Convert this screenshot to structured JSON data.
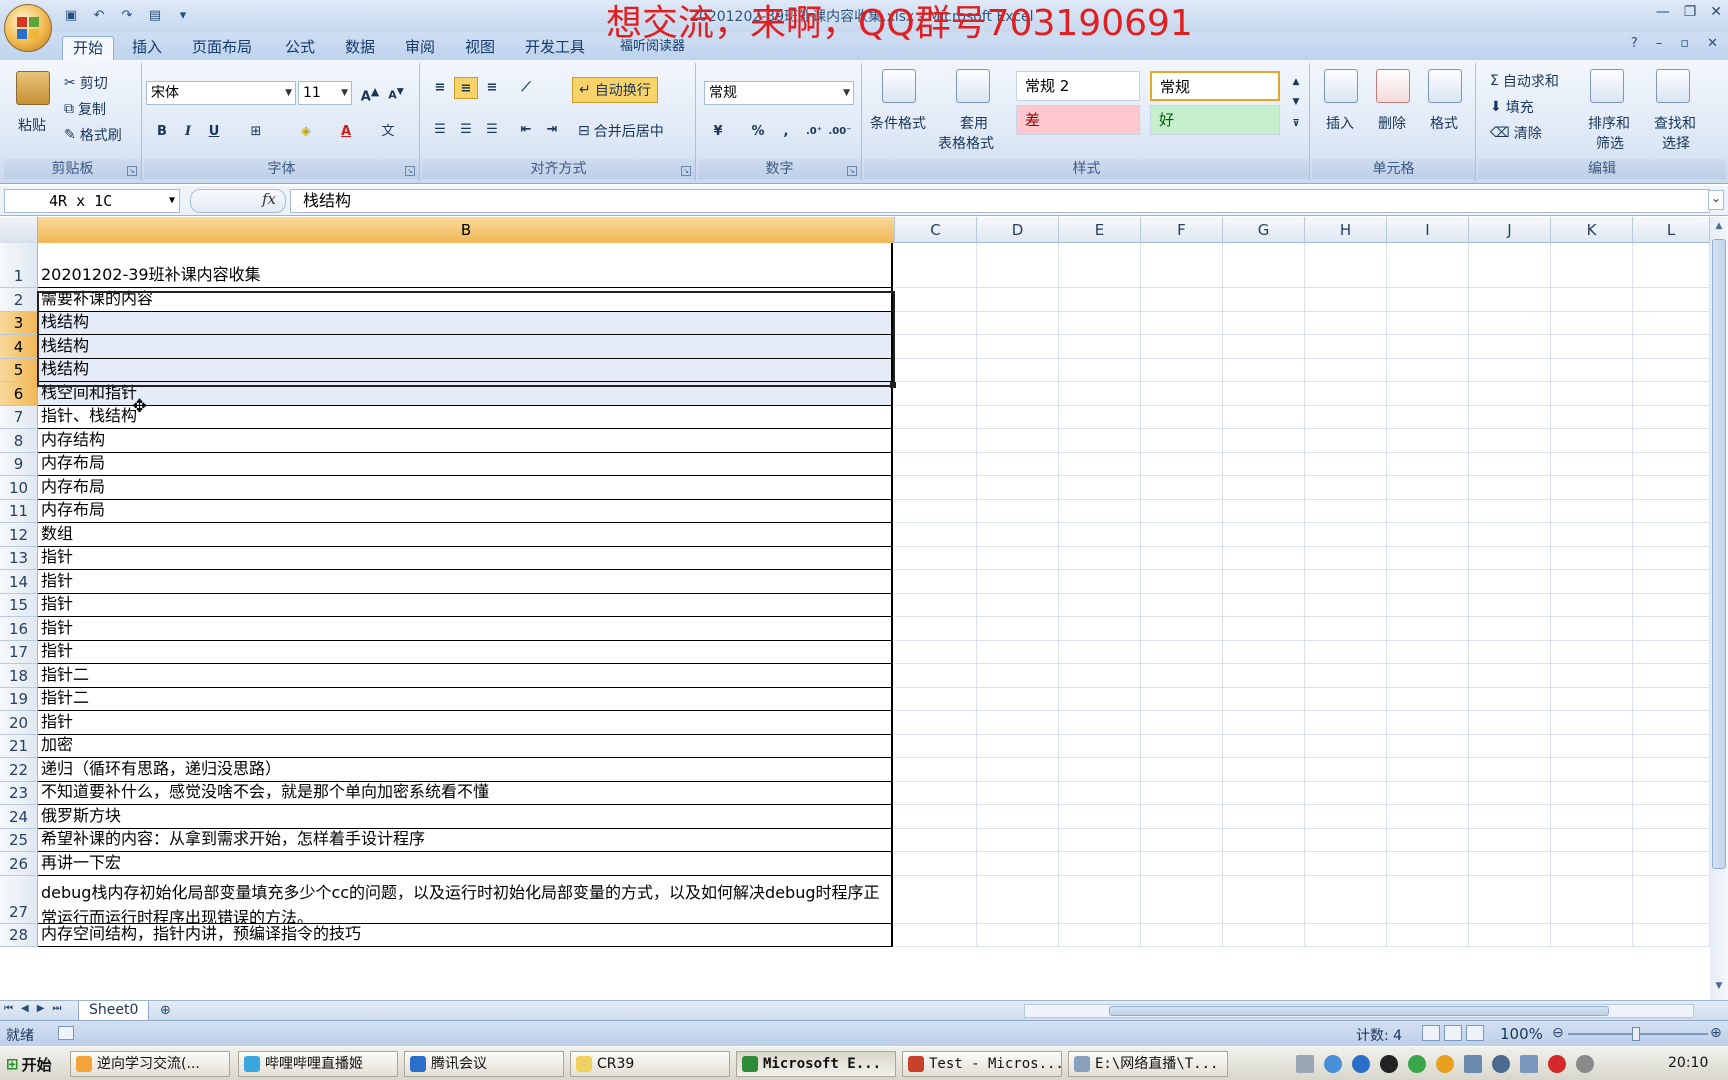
{
  "window": {
    "doc_title": "20201202-39班补课内容收集.xlsx - Microsoft Excel",
    "watermark": "想交流，来啊，QQ群号703190691"
  },
  "tabs": [
    "开始",
    "插入",
    "页面布局",
    "公式",
    "数据",
    "审阅",
    "视图",
    "开发工具",
    "福听阅读器"
  ],
  "ribbon": {
    "clipboard": {
      "label": "剪贴板",
      "paste": "粘贴",
      "cut": "剪切",
      "copy": "复制",
      "format_painter": "格式刷"
    },
    "font": {
      "label": "字体",
      "font_name": "宋体",
      "font_size": "11"
    },
    "alignment": {
      "label": "对齐方式",
      "wrap_text": "自动换行",
      "merge_center": "合并后居中"
    },
    "number": {
      "label": "数字",
      "format": "常规"
    },
    "styles": {
      "label": "样式",
      "conditional": "条件格式",
      "table_format_1": "套用",
      "table_format_2": "表格格式",
      "normal2": "常规 2",
      "normal": "常规",
      "bad": "差",
      "good": "好"
    },
    "cells": {
      "label": "单元格",
      "insert": "插入",
      "delete": "删除",
      "format": "格式"
    },
    "editing": {
      "label": "编辑",
      "autosum": "自动求和",
      "fill": "填充",
      "clear": "清除",
      "sort_1": "排序和",
      "sort_2": "筛选",
      "find_1": "查找和",
      "find_2": "选择"
    }
  },
  "formula_bar": {
    "name_box": "4R x 1C",
    "fx": "fx",
    "content": "栈结构"
  },
  "columns": [
    "B",
    "C",
    "D",
    "E",
    "F",
    "G",
    "H",
    "I",
    "J",
    "K",
    "L"
  ],
  "rows": [
    {
      "n": "1",
      "text": "20201202-39班补课内容收集"
    },
    {
      "n": "2",
      "text": "需要补课的内容"
    },
    {
      "n": "3",
      "text": "栈结构"
    },
    {
      "n": "4",
      "text": "栈结构"
    },
    {
      "n": "5",
      "text": "栈结构"
    },
    {
      "n": "6",
      "text": "栈空间和指针"
    },
    {
      "n": "7",
      "text": "指针、栈结构"
    },
    {
      "n": "8",
      "text": "内存结构"
    },
    {
      "n": "9",
      "text": "内存布局"
    },
    {
      "n": "10",
      "text": "内存布局"
    },
    {
      "n": "11",
      "text": "内存布局"
    },
    {
      "n": "12",
      "text": "数组"
    },
    {
      "n": "13",
      "text": "指针"
    },
    {
      "n": "14",
      "text": "指针"
    },
    {
      "n": "15",
      "text": "指针"
    },
    {
      "n": "16",
      "text": "指针"
    },
    {
      "n": "17",
      "text": "指针"
    },
    {
      "n": "18",
      "text": "指针二"
    },
    {
      "n": "19",
      "text": "指针二"
    },
    {
      "n": "20",
      "text": "指针"
    },
    {
      "n": "21",
      "text": "加密"
    },
    {
      "n": "22",
      "text": "递归（循环有思路，递归没思路）"
    },
    {
      "n": "23",
      "text": "不知道要补什么，感觉没啥不会，就是那个单向加密系统看不懂"
    },
    {
      "n": "24",
      "text": "俄罗斯方块"
    },
    {
      "n": "25",
      "text": "希望补课的内容：从拿到需求开始，怎样着手设计程序"
    },
    {
      "n": "26",
      "text": "再讲一下宏"
    },
    {
      "n": "27",
      "text": "debug栈内存初始化局部变量填充多少个cc的问题，以及运行时初始化局部变量的方式，以及如何解决debug时程序正常运行而运行时程序出现错误的方法。"
    },
    {
      "n": "28",
      "text": "内存空间结构，指针内讲，预编译指令的技巧"
    }
  ],
  "sheet_tab": "Sheet0",
  "status": {
    "ready": "就绪",
    "count": "计数: 4",
    "zoom": "100%"
  },
  "taskbar": {
    "start": "开始",
    "tasks": [
      "逆向学习交流(...",
      "哔哩哔哩直播姬",
      "腾讯会议",
      "CR39",
      "Microsoft E...",
      "Test - Micros...",
      "E:\\网络直播\\T..."
    ],
    "clock": "20:10"
  }
}
